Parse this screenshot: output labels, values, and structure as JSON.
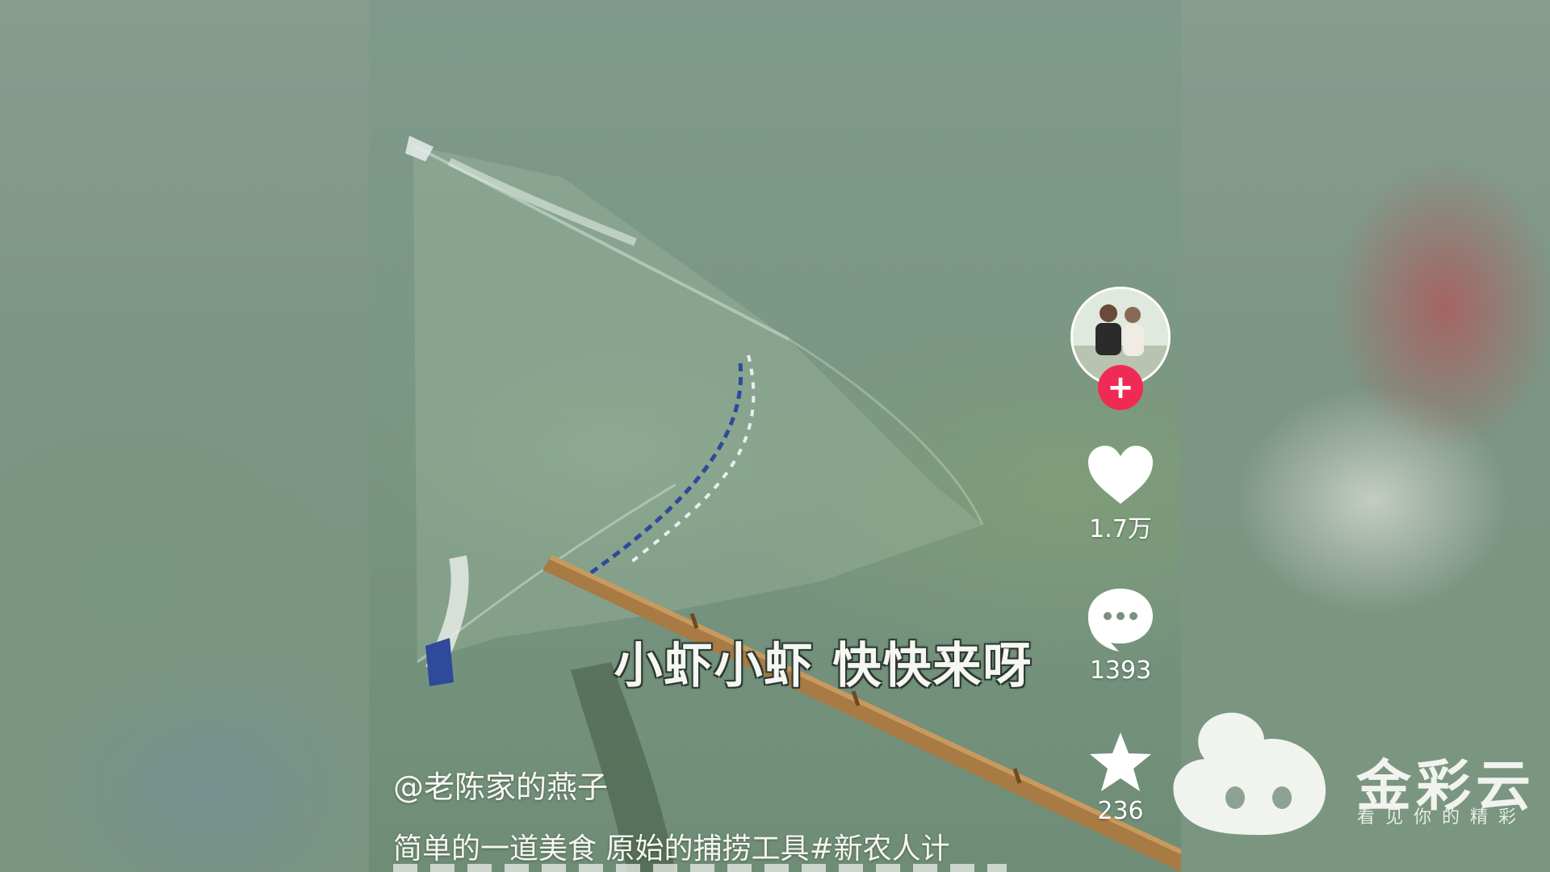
{
  "video": {
    "subtitle": "小虾小虾 快快来呀",
    "author": "@老陈家的燕子",
    "caption": "简单的一道美食 原始的捕捞工具#新农人计"
  },
  "actions": {
    "likes": "1.7万",
    "comments": "1393",
    "favorites": "236"
  },
  "watermark": {
    "name": "金彩云",
    "slogan": "看见你的精彩"
  },
  "colors": {
    "follow": "#ef2b55",
    "icon": "#ffffff"
  }
}
